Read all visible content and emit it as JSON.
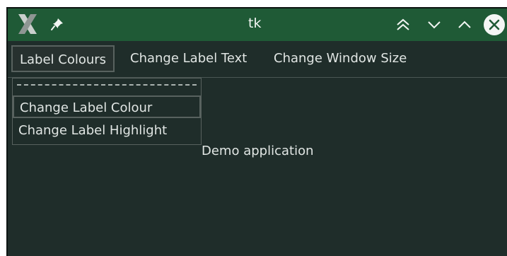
{
  "window": {
    "title": "tk",
    "icons": {
      "app": "x-logo-icon",
      "pin": "pin-icon",
      "shade": "double-chevron-up-icon",
      "minimize": "chevron-down-icon",
      "maximize": "chevron-up-icon",
      "close": "close-icon"
    }
  },
  "menubar": {
    "items": [
      {
        "label": "Label Colours"
      },
      {
        "label": "Change Label Text"
      },
      {
        "label": "Change Window Size"
      }
    ]
  },
  "dropdown": {
    "items": [
      {
        "label": "Change Label Colour"
      },
      {
        "label": "Change Label Highlight"
      }
    ]
  },
  "main": {
    "label": "Demo application"
  },
  "colors": {
    "titlebar": "#1f5a36",
    "background": "#1f2d2a",
    "text": "#e1e6e4",
    "border": "#58625f"
  }
}
